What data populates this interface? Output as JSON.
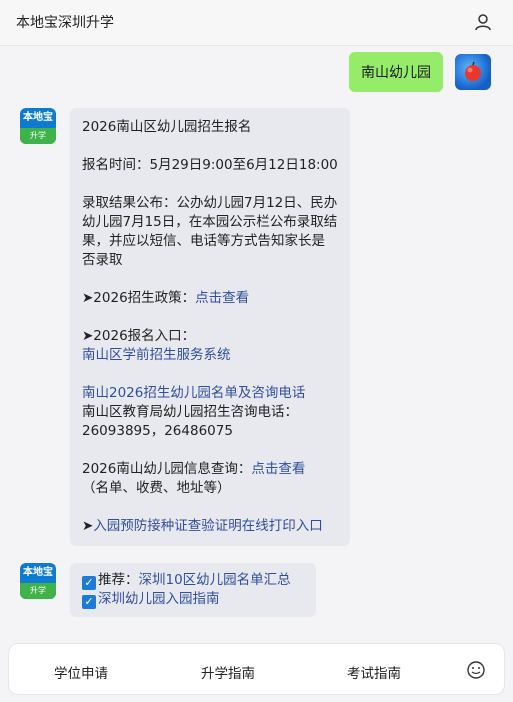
{
  "header": {
    "title": "本地宝深圳升学"
  },
  "user_message": {
    "text": "南山幼儿园"
  },
  "bot_avatar": {
    "top": "本地宝",
    "bottom": "升学"
  },
  "reply": {
    "title": "2026南山区幼儿园招生报名",
    "signup_time": "报名时间：5月29日9:00至6月12日18:00",
    "result_text": "录取结果公布：公办幼儿园7月12日、民办幼儿园7月15日，在本园公示栏公布录取结果，并应以短信、电话等方式告知家长是否录取",
    "policy_prefix": "➤2026招生政策：",
    "policy_link": "点击查看",
    "entry_prefix": "➤2026报名入口：",
    "entry_link": "南山区学前招生服务系统",
    "list_link": "南山2026招生幼儿园名单及咨询电话",
    "phone_label": "南山区教育局幼儿园招生咨询电话：",
    "phone_numbers": "26093895，26486075",
    "info_prefix": "2026南山幼儿园信息查询：",
    "info_link": "点击查看",
    "info_note": "（名单、收费、地址等）",
    "print_prefix": "➤",
    "print_link": "入园预防接种证查验证明在线打印入口"
  },
  "recommend": {
    "check1": "✓",
    "prefix": "推荐：",
    "link1": "深圳10区幼儿园名单汇总",
    "check2": "✓",
    "link2": "深圳幼儿园入园指南"
  },
  "bottom_nav": [
    {
      "label": "学位申请"
    },
    {
      "label": "升学指南"
    },
    {
      "label": "考试指南"
    }
  ]
}
